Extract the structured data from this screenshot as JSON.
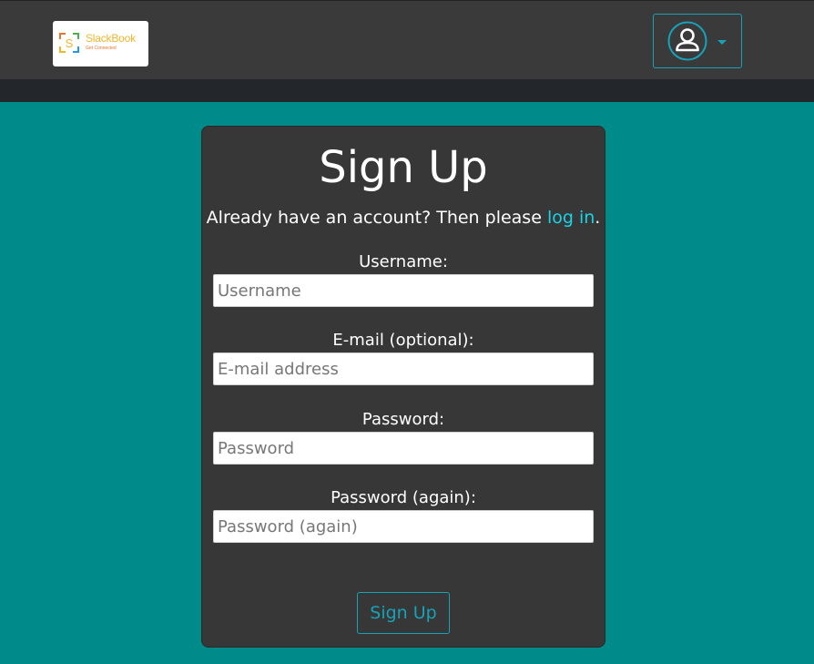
{
  "header": {
    "logo": {
      "name": "SlackBook",
      "tagline": "Get Connected",
      "mark_letter": "S"
    },
    "user_menu": {
      "icon": "user-circle-icon",
      "caret_icon": "caret-down-icon",
      "accent": "#17a2b8"
    }
  },
  "signup": {
    "title": "Sign Up",
    "lead_text": "Already have an account? Then please ",
    "login_link": "log in",
    "lead_end": ".",
    "fields": [
      {
        "label": "Username:",
        "placeholder": "Username",
        "value": ""
      },
      {
        "label": "E-mail (optional):",
        "placeholder": "E-mail address",
        "value": ""
      },
      {
        "label": "Password:",
        "placeholder": "Password",
        "value": ""
      },
      {
        "label": "Password (again):",
        "placeholder": "Password (again)",
        "value": ""
      }
    ],
    "submit_label": "Sign Up"
  },
  "colors": {
    "page_background": "#008b8b",
    "navbar": "#3a3a3a",
    "card": "#373737",
    "link": "#17d4e6",
    "button_outline": "#17a2b8"
  }
}
